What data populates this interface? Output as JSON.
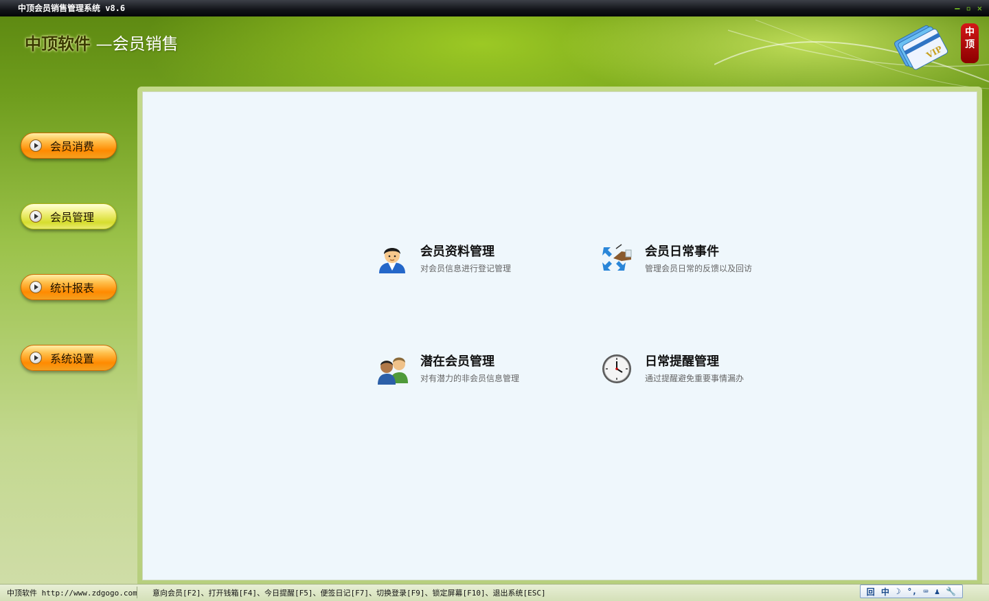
{
  "window": {
    "title": "中顶会员销售管理系统 v8.6",
    "minimize_glyph": "–",
    "restore_glyph": "▫",
    "close_glyph": "✕"
  },
  "header": {
    "brand_company": "中顶软件",
    "brand_product": "—会员销售",
    "seal_text": "中顶",
    "logo_text": "VIP"
  },
  "sidebar": {
    "items": [
      {
        "label": "会员消费",
        "style": "orange"
      },
      {
        "label": "会员管理",
        "style": "yellow"
      },
      {
        "label": "统计报表",
        "style": "orange"
      },
      {
        "label": "系统设置",
        "style": "orange"
      }
    ]
  },
  "main": {
    "features": [
      {
        "title": "会员资料管理",
        "desc": "对会员信息进行登记管理",
        "icon": "member-profile-icon"
      },
      {
        "title": "会员日常事件",
        "desc": "管理会员日常的反馈以及回访",
        "icon": "daily-events-icon"
      },
      {
        "title": "潜在会员管理",
        "desc": "对有潜力的非会员信息管理",
        "icon": "potential-members-icon"
      },
      {
        "title": "日常提醒管理",
        "desc": "通过提醒避免重要事情漏办",
        "icon": "clock-icon"
      }
    ]
  },
  "statusbar": {
    "company": "中顶软件 http://www.zdgogo.com",
    "shortcuts": "意向会员[F2]、打开钱箱[F4]、今日提醒[F5]、便签日记[F7]、切换登录[F9]、锁定屏幕[F10]、退出系统[ESC]",
    "ime": {
      "mode": "中",
      "moon": "☽",
      "punct": "°,",
      "keyboard": "⌨",
      "user": "♟",
      "tool": "🔧",
      "logo": "回"
    }
  },
  "colors": {
    "accent_green": "#7fd321",
    "panel_bg": "#eff7fc"
  }
}
